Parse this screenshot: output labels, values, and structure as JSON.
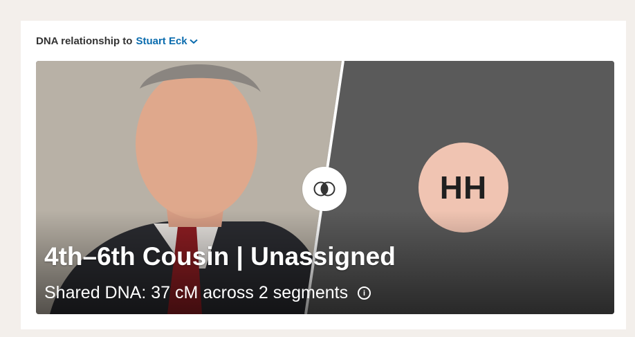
{
  "header": {
    "label": "DNA relationship to",
    "person_link": "Stuart Eck"
  },
  "match": {
    "avatar_initials": "HH",
    "relationship": "4th–6th Cousin | Unassigned",
    "shared_dna": "Shared DNA: 37 cM across 2 segments",
    "info_glyph": "i"
  },
  "colors": {
    "link": "#0b6cae",
    "avatar_bg": "#f0c4b2",
    "right_panel": "#5a5a5a"
  },
  "icons": {
    "dropdown": "chevron-down-icon",
    "compare": "overlap-circles-icon",
    "info": "info-icon"
  }
}
